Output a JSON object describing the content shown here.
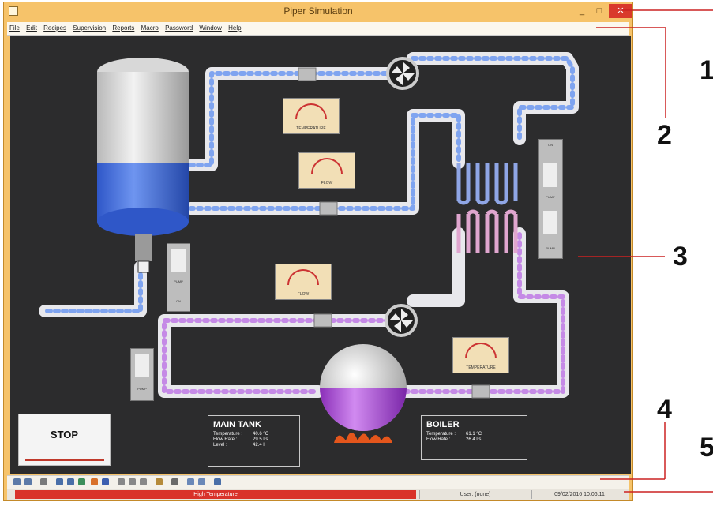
{
  "window": {
    "title": "Piper Simulation",
    "min_glyph": "_",
    "max_glyph": "□",
    "close_glyph": "✕"
  },
  "menu": [
    "File",
    "Edit",
    "Recipes",
    "Supervision",
    "Reports",
    "Macro",
    "Password",
    "Window",
    "Help"
  ],
  "stop_button": {
    "label": "STOP"
  },
  "main_tank": {
    "title": "MAIN TANK",
    "rows": [
      {
        "label": "Temperature :",
        "value": "40.6 °C"
      },
      {
        "label": "Flow Rate :",
        "value": "29.5 l/s"
      },
      {
        "label": "Level :",
        "value": "42.4 l"
      }
    ]
  },
  "boiler": {
    "title": "BOILER",
    "rows": [
      {
        "label": "Temperature :",
        "value": "61.1 °C"
      },
      {
        "label": "Flow Rate :",
        "value": "26.4 l/s"
      }
    ]
  },
  "gauges": {
    "temperature": "TEMPERATURE",
    "flow": "FLOW"
  },
  "pump_panels": {
    "pump": "PUMP",
    "on": "ON"
  },
  "status": {
    "alarm": "High Temperature",
    "user": "User: (none)",
    "datetime": "09/02/2016 10:06:11"
  },
  "callouts": [
    "1",
    "2",
    "3",
    "4",
    "5"
  ],
  "colors": {
    "accent_window": "#f6c36a",
    "alarm": "#d9322a",
    "canvas": "#2c2c2d"
  }
}
